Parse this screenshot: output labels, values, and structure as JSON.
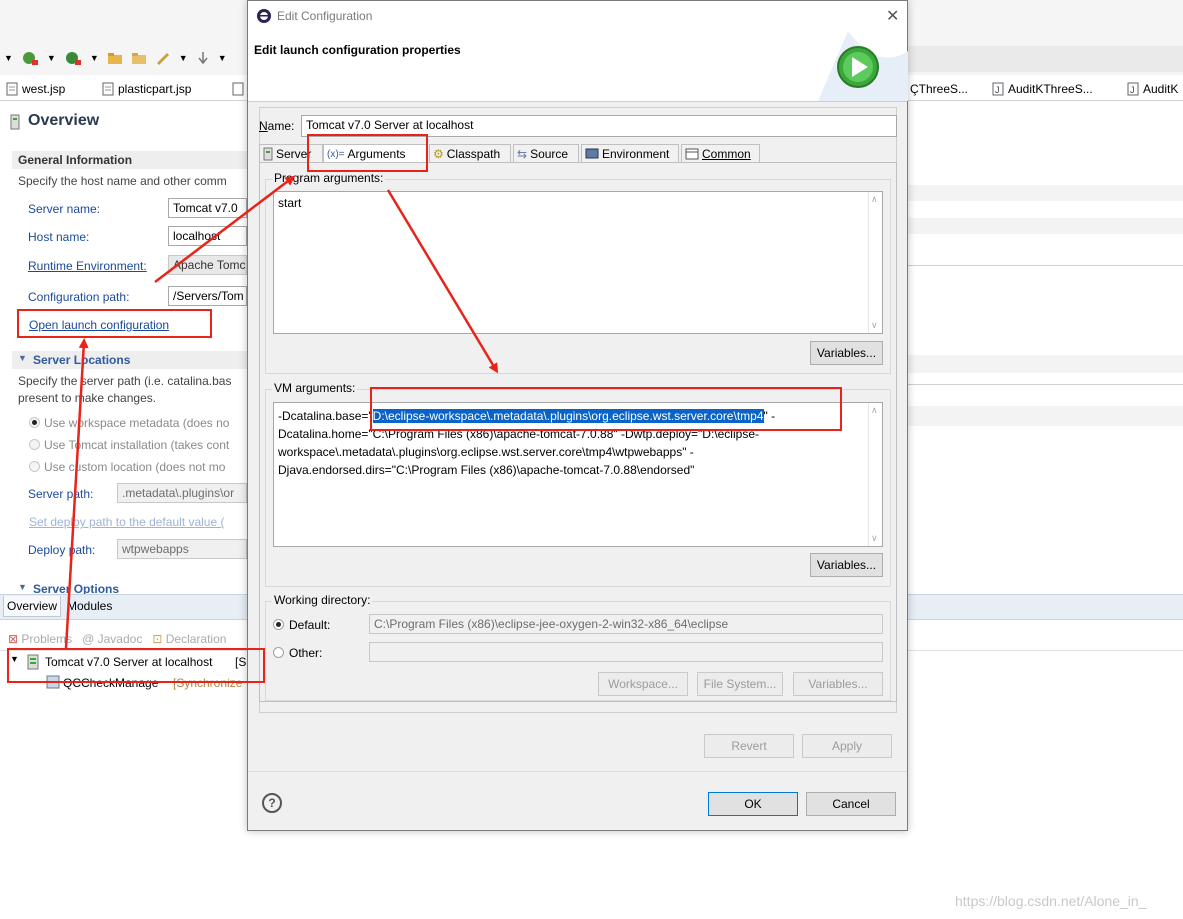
{
  "bg_toolbar": {
    "tabs": [
      "west.jsp",
      "plasticpart.jsp",
      "ÇThreeS...",
      "AuditKThreeS...",
      "AuditK"
    ]
  },
  "overview": {
    "title": "Overview",
    "general_info": {
      "heading": "General Information",
      "desc": "Specify the host name and other comm",
      "server_name_label": "Server name:",
      "server_name_value": "Tomcat v7.0",
      "host_name_label": "Host name:",
      "host_name_value": "localhost",
      "runtime_env_label": "Runtime Environment:",
      "runtime_env_value": "Apache Tomc",
      "config_path_label": "Configuration path:",
      "config_path_value": "/Servers/Tom",
      "open_launch_link": "Open launch configuration"
    },
    "server_locations": {
      "heading": "Server Locations",
      "desc1": "Specify the server path (i.e. catalina.bas",
      "desc2": "present to make changes.",
      "opt1": "Use workspace metadata (does no",
      "opt2": "Use Tomcat installation (takes cont",
      "opt3": "Use custom location (does not mo",
      "server_path_label": "Server path:",
      "server_path_value": ".metadata\\.plugins\\or",
      "set_deploy_link": "Set deploy path to the default value (",
      "deploy_path_label": "Deploy path:",
      "deploy_path_value": "wtpwebapps"
    },
    "server_options": {
      "heading": "Server Options"
    },
    "bottom_tabs": [
      "Overview",
      "Modules"
    ]
  },
  "servers_view": {
    "tabs": [
      "Problems",
      "Javadoc",
      "Declaration"
    ],
    "server_item": "Tomcat v7.0 Server at localhost",
    "server_suffix": "[S",
    "child_item": "QCCheckManage",
    "child_suffix": "[Synchronize"
  },
  "dialog": {
    "window_title": "Edit Configuration",
    "header_title": "Edit launch configuration properties",
    "name_label": "Name:",
    "name_value": "Tomcat v7.0 Server at localhost",
    "tabs": [
      "Server",
      "Arguments",
      "Classpath",
      "Source",
      "Environment",
      "Common"
    ],
    "program_args_label": "Program arguments:",
    "program_args_value": "start",
    "variables_label": "Variables...",
    "vm_args_label": "VM arguments:",
    "vm_line1_pre": "-Dcatalina.base=\"",
    "vm_line1_sel": "D:\\eclipse-workspace\\.metadata\\.plugins\\org.eclipse.wst.server.core\\tmp4",
    "vm_line1_post": "\" -",
    "vm_line2": "Dcatalina.home=\"C:\\Program Files (x86)\\apache-tomcat-7.0.88\" -Dwtp.deploy=\"D:\\eclipse-",
    "vm_line3": "workspace\\.metadata\\.plugins\\org.eclipse.wst.server.core\\tmp4\\wtpwebapps\" -",
    "vm_line4": "Djava.endorsed.dirs=\"C:\\Program Files (x86)\\apache-tomcat-7.0.88\\endorsed\"",
    "working_dir_label": "Working directory:",
    "default_label": "Default:",
    "default_value": "C:\\Program Files (x86)\\eclipse-jee-oxygen-2-win32-x86_64\\eclipse",
    "other_label": "Other:",
    "workspace_btn": "Workspace...",
    "filesystem_btn": "File System...",
    "variables_btn": "Variables...",
    "revert_btn": "Revert",
    "apply_btn": "Apply",
    "ok_btn": "OK",
    "cancel_btn": "Cancel",
    "help_glyph": "?"
  },
  "watermark": "https://blog.csdn.net/Alone_in_",
  "colors": {
    "annotation_red": "#e8231a",
    "selection_blue": "#0a64c8",
    "link_blue": "#1a4a9c"
  }
}
